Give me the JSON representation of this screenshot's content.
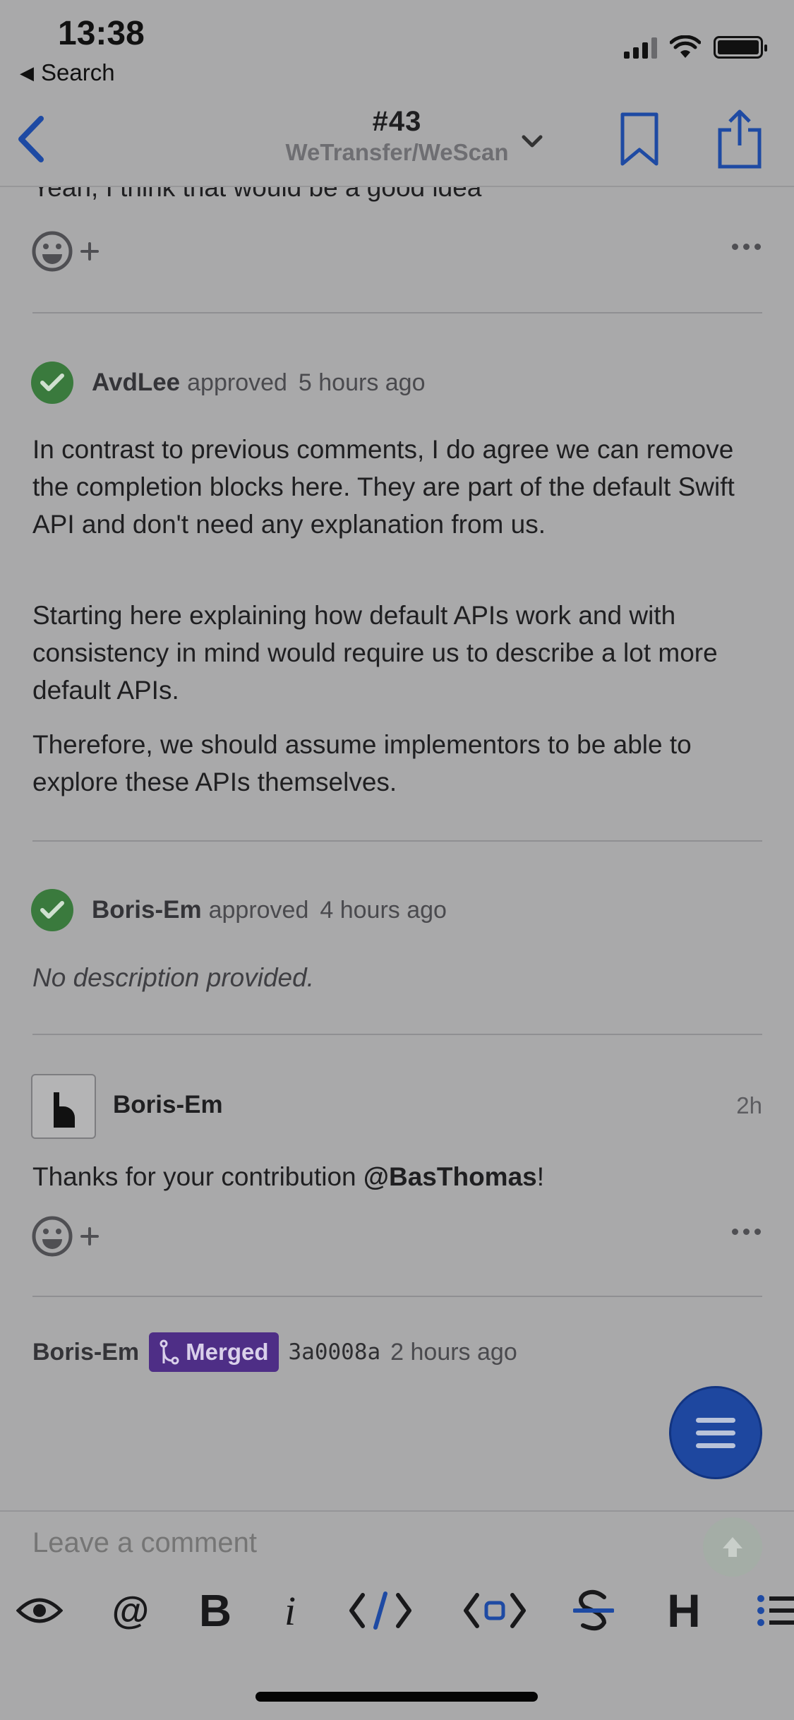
{
  "status_bar": {
    "time": "13:38",
    "back_app": "Search"
  },
  "nav": {
    "number": "#43",
    "repo": "WeTransfer/WeScan"
  },
  "partial_comment": {
    "text": "Yeah, I think that would be a good idea"
  },
  "reviews": [
    {
      "author": "AvdLee",
      "action": "approved",
      "time": "5 hours ago",
      "paragraphs": [
        "In contrast to previous comments, I do agree we can remove the completion blocks here. They are part of the default Swift API and don't need any explanation from us.",
        "Starting here explaining how default APIs work and with consistency in mind would require us to describe a lot more default APIs.",
        "Therefore, we should assume implementors to be able to explore these APIs themselves."
      ]
    },
    {
      "author": "Boris-Em",
      "action": "approved",
      "time": "4 hours ago",
      "body": "No description provided."
    }
  ],
  "comment": {
    "author": "Boris-Em",
    "time": "2h",
    "text_before": "Thanks for your contribution ",
    "mention": "@BasThomas",
    "text_after": "!"
  },
  "merge_event": {
    "author": "Boris-Em",
    "badge": "Merged",
    "sha": "3a0008a",
    "time": "2 hours ago"
  },
  "composer": {
    "placeholder": "Leave a comment"
  },
  "toolbar_icons": [
    "eye-icon",
    "at-icon",
    "bold-icon",
    "italic-icon",
    "code-icon",
    "code-block-icon",
    "strikethrough-icon",
    "heading-icon",
    "list-icon"
  ],
  "colors": {
    "approved": "#3a7a3d",
    "merged": "#4e2e86",
    "accent": "#1e479f"
  }
}
